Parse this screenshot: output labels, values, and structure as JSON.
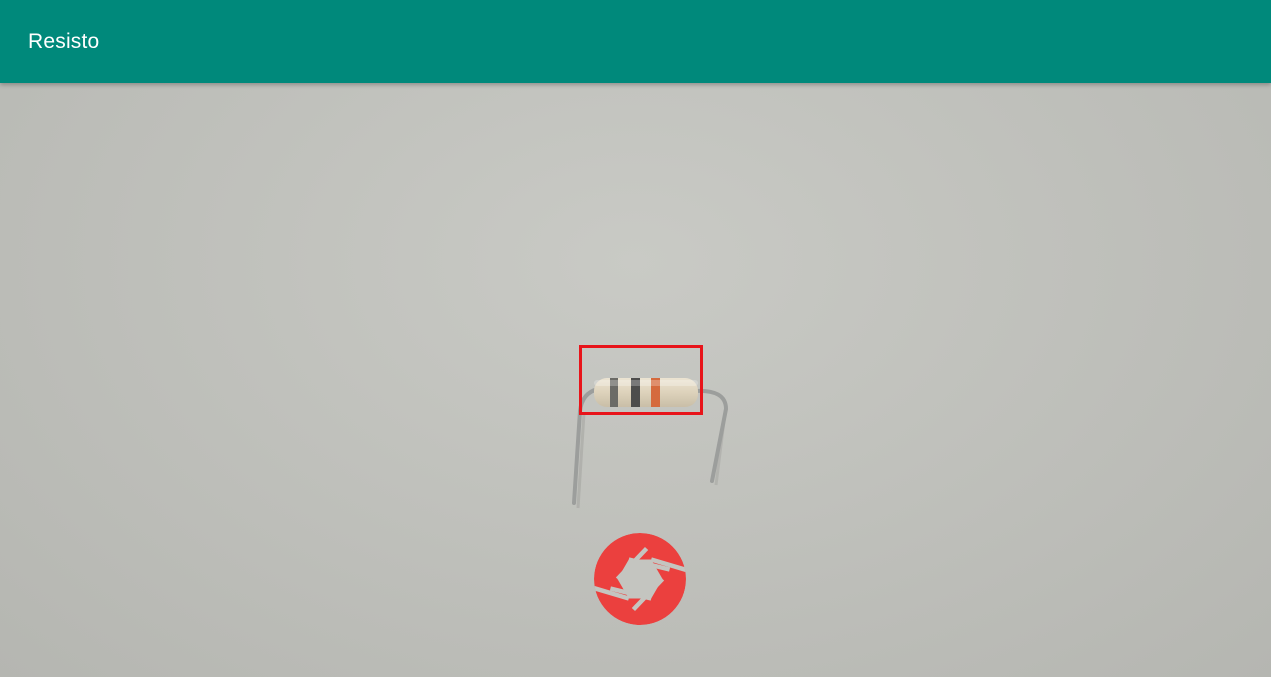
{
  "app_bar": {
    "title": "Resisto",
    "background_color": "#00897b"
  },
  "camera_preview": {
    "detection_box_color": "#e8141a",
    "resistor_bands": [
      "#6b6b66",
      "#4d4d4c",
      "#d56a3d"
    ]
  },
  "shutter": {
    "icon": "camera-aperture-icon",
    "color": "#eb403e"
  }
}
